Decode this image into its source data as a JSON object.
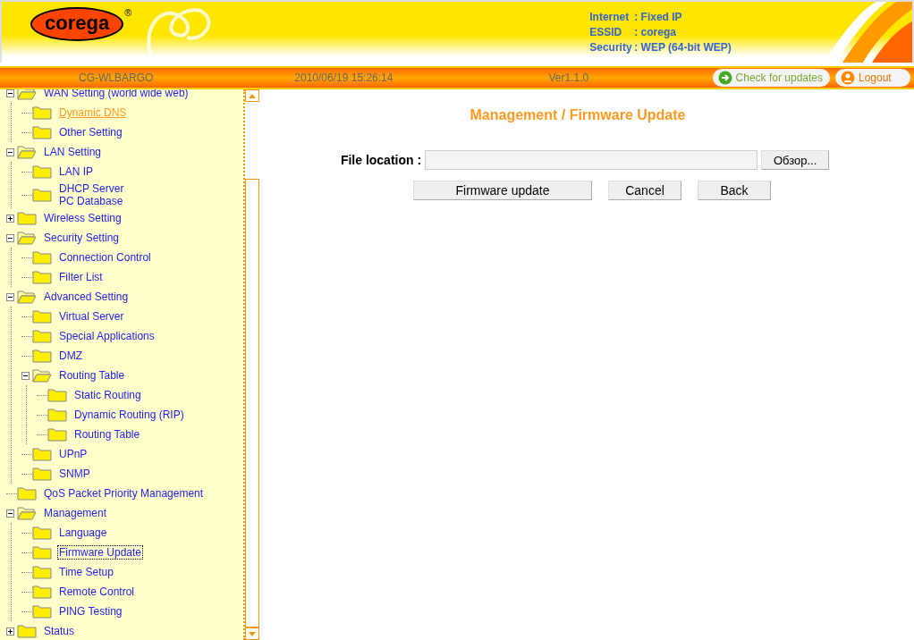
{
  "header": {
    "logo": "corega",
    "logo_mark": "®",
    "info": [
      {
        "label": "Internet",
        "value": ": Fixed IP"
      },
      {
        "label": "ESSID",
        "value": ": corega"
      },
      {
        "label": "Security",
        "value": ": WEP (64-bit WEP)"
      }
    ]
  },
  "status_bar": {
    "model": "CG-WLBARGO",
    "datetime": "2010/06/19 15:26:14",
    "version": "Ver1.1.0",
    "check_updates": "Check for updates",
    "logout": "Logout"
  },
  "sidebar": {
    "items": [
      {
        "label": "WAN Setting (world wide web)",
        "expanded": true,
        "selected": false,
        "hovered": false,
        "children": [
          {
            "label": "Dynamic DNS",
            "selected": false,
            "hovered": true
          },
          {
            "label": "Other Setting",
            "selected": false,
            "hovered": false
          }
        ]
      },
      {
        "label": "LAN Setting",
        "expanded": true,
        "selected": false,
        "hovered": false,
        "children": [
          {
            "label": "LAN IP",
            "selected": false,
            "hovered": false
          },
          {
            "label": "DHCP Server\nPC Database",
            "selected": false,
            "hovered": false
          }
        ]
      },
      {
        "label": "Wireless Setting",
        "expanded": false,
        "selected": false,
        "hovered": false
      },
      {
        "label": "Security Setting",
        "expanded": true,
        "selected": false,
        "hovered": false,
        "children": [
          {
            "label": "Connection Control",
            "selected": false,
            "hovered": false
          },
          {
            "label": "Filter List",
            "selected": false,
            "hovered": false
          }
        ]
      },
      {
        "label": "Advanced Setting",
        "expanded": true,
        "selected": false,
        "hovered": false,
        "children": [
          {
            "label": "Virtual Server",
            "selected": false,
            "hovered": false
          },
          {
            "label": "Special Applications",
            "selected": false,
            "hovered": false
          },
          {
            "label": "DMZ",
            "selected": false,
            "hovered": false
          },
          {
            "label": "Routing Table",
            "expanded": true,
            "selected": false,
            "hovered": false,
            "children": [
              {
                "label": "Static Routing",
                "selected": false,
                "hovered": false
              },
              {
                "label": "Dynamic Routing (RIP)",
                "selected": false,
                "hovered": false
              },
              {
                "label": "Routing Table",
                "selected": false,
                "hovered": false
              }
            ]
          },
          {
            "label": "UPnP",
            "selected": false,
            "hovered": false
          },
          {
            "label": "SNMP",
            "selected": false,
            "hovered": false
          }
        ]
      },
      {
        "label": "QoS Packet Priority Management",
        "selected": false,
        "hovered": false
      },
      {
        "label": "Management",
        "expanded": true,
        "selected": false,
        "hovered": false,
        "children": [
          {
            "label": "Language",
            "selected": false,
            "hovered": false
          },
          {
            "label": "Firmware Update",
            "selected": true,
            "hovered": false
          },
          {
            "label": "Time Setup",
            "selected": false,
            "hovered": false
          },
          {
            "label": "Remote Control",
            "selected": false,
            "hovered": false
          },
          {
            "label": "PING Testing",
            "selected": false,
            "hovered": false
          }
        ]
      },
      {
        "label": "Status",
        "expanded": false,
        "selected": false,
        "hovered": false
      }
    ]
  },
  "content": {
    "title": "Management / Firmware Update",
    "file_label": "File location :",
    "browse": "Обзор...",
    "buttons": [
      "Firmware update",
      "Cancel",
      "Back"
    ]
  }
}
